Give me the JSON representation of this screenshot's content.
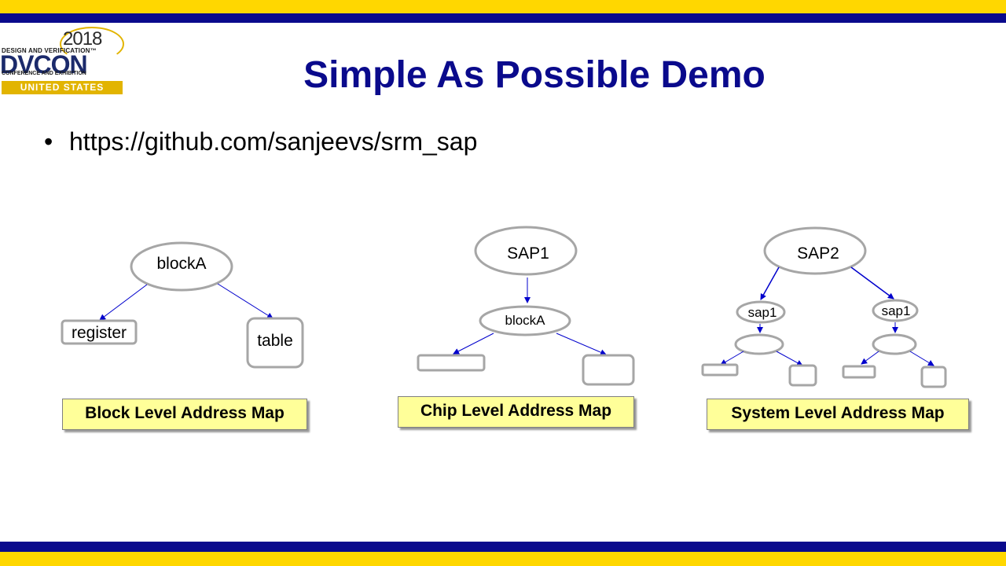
{
  "colors": {
    "band_yellow": "#ffd700",
    "band_blue": "#0a0a8c",
    "title": "#0a0a8c",
    "arrow": "#0000cc",
    "node_border": "#a6a6a6",
    "label_fill": "#ffff99"
  },
  "logo": {
    "year": "2018",
    "line1": "DESIGN AND VERIFICATION™",
    "name": "DVCON",
    "line3": "CONFERENCE AND EXHIBITION",
    "region": "UNITED STATES"
  },
  "title": "Simple As Possible Demo",
  "bullet": {
    "symbol": "•",
    "text": "https://github.com/sanjeevs/srm_sap"
  },
  "block_map": {
    "root": "blockA",
    "child_left": "register",
    "child_right": "table",
    "label": "Block Level Address Map"
  },
  "chip_map": {
    "root": "SAP1",
    "child": "blockA",
    "label": "Chip Level Address Map"
  },
  "system_map": {
    "root": "SAP2",
    "child_left": "sap1",
    "child_right": "sap1",
    "label": "System Level Address Map"
  }
}
